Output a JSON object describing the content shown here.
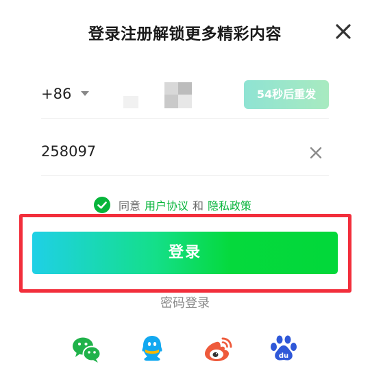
{
  "dialog": {
    "title": "登录注册解锁更多精彩内容"
  },
  "phone": {
    "country_code": "+86"
  },
  "resend_label": "54秒后重发",
  "code": {
    "value": "258097"
  },
  "agreement": {
    "prefix": "同意",
    "user_agreement": "用户协议",
    "conjunction": "和",
    "privacy_policy": "隐私政策"
  },
  "login_button_label": "登录",
  "password_login_label": "密码登录",
  "social_logins": [
    "wechat-icon",
    "qq-icon",
    "weibo-icon",
    "baidu-icon"
  ],
  "colors": {
    "accent_green": "#07b53b",
    "highlight_red": "#f22e3b",
    "button_gradient_start": "#1fd0e6",
    "button_gradient_end": "#02d83a"
  }
}
